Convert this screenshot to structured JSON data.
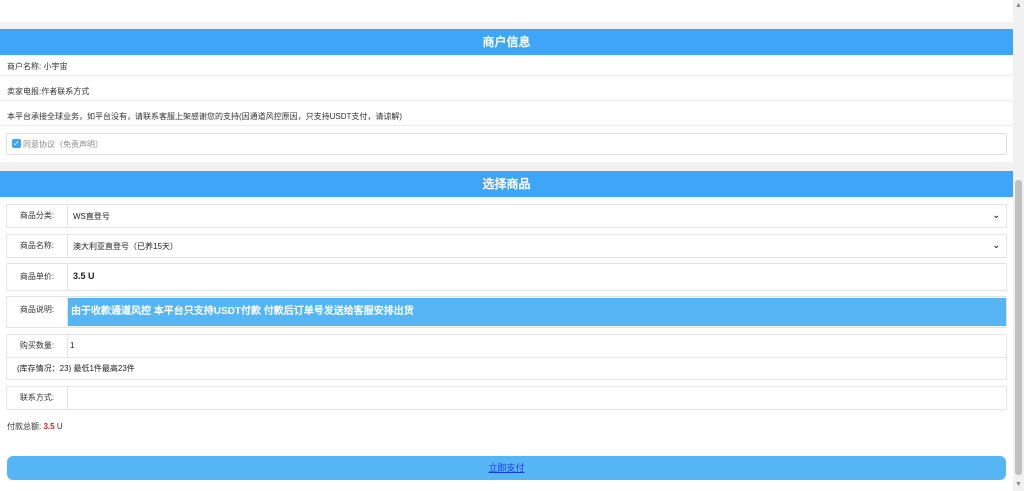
{
  "merchant": {
    "header": "商户信息",
    "name_label": "商户名称:",
    "name_value": "小宇宙",
    "telegram_line": "卖家电报:作者联系方式",
    "notice": "本平台承接全球业务，如平台没有，请联系客服上架感谢您的支持(因通道风控原因，只支持USDT支付，请谅解)",
    "agree_text": "同意协议（免责声明）",
    "agree_checked": true
  },
  "goods": {
    "header": "选择商品",
    "category_label": "商品分类:",
    "category_value": "WS直登号",
    "name_label": "商品名称:",
    "name_value": "澳大利亚直登号（已养15天）",
    "price_label": "商品单价:",
    "price_value": "3.5 U",
    "desc_label": "商品说明:",
    "desc_value": "由于收款通道风控 本平台只支持USDT付款 付款后订单号发送给客服安排出货",
    "qty_label": "购买数量:",
    "qty_value": "1",
    "stock_info": "(库存情况：23)  最低1件最高23件",
    "contact_label": "联系方式:",
    "contact_value": ""
  },
  "payment": {
    "total_label": "付款总额:",
    "total_amount": "3.5",
    "total_unit": "U",
    "pay_button": "立即支付"
  },
  "icons": {
    "check": "checkmark-icon",
    "dropdown": "chevron-down-icon"
  },
  "colors": {
    "accent": "#3ea6f8",
    "description_bg": "#56b6f5",
    "total_amount": "#e02020"
  }
}
